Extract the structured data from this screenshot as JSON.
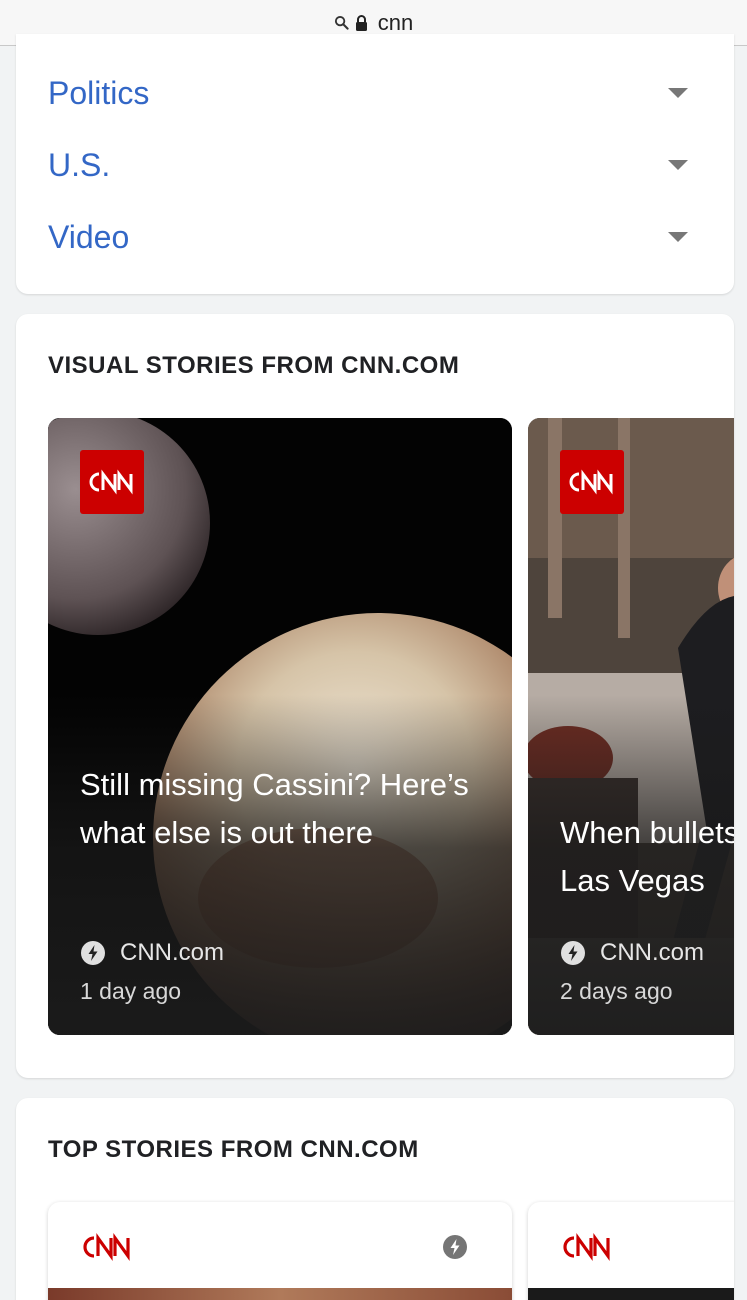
{
  "browser": {
    "url": "cnn"
  },
  "nav": {
    "items": [
      {
        "label": "Politics"
      },
      {
        "label": "U.S."
      },
      {
        "label": "Video"
      }
    ]
  },
  "visual_stories": {
    "heading": "VISUAL STORIES FROM CNN.COM",
    "brand_logo": "CNN",
    "items": [
      {
        "title": "Still missing Cassini? Here’s what else is out there",
        "source": "CNN.com",
        "age": "1 day ago",
        "image": "pluto-and-charon"
      },
      {
        "title": "When bullets on Las Vegas",
        "source": "CNN.com",
        "age": "2 days ago",
        "image": "las-vegas-crowd"
      }
    ]
  },
  "top_stories": {
    "heading": "TOP STORIES FROM CNN.COM",
    "brand_logo": "CNN"
  },
  "colors": {
    "link": "#3367c6",
    "cnn_red": "#cc0000",
    "page_bg": "#f1f3f4"
  }
}
